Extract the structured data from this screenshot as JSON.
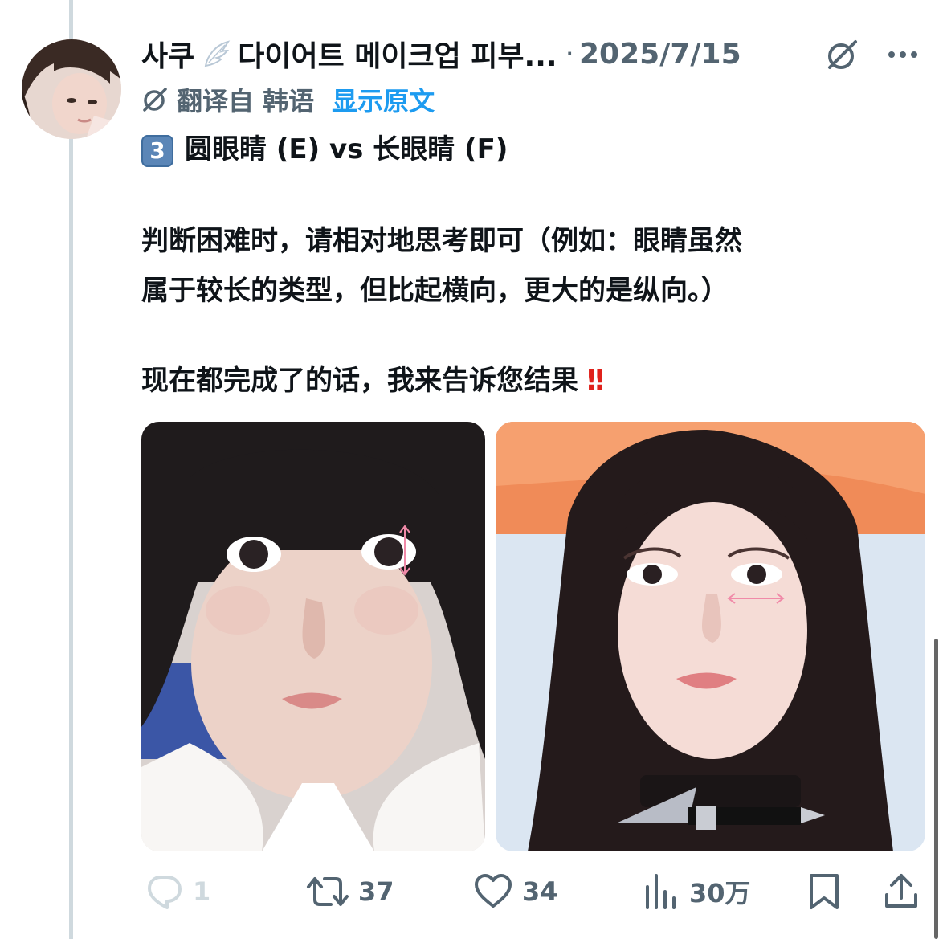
{
  "post": {
    "display_name": "사쿠",
    "name_rest": "다이어트 메이크업 피부...",
    "separator": "·",
    "date": "2025/7/15",
    "translated_from": "翻译自 韩语",
    "show_original": "显示原文",
    "keycap": "3",
    "heading": "圆眼睛 (E) vs 长眼睛 (F)",
    "line1": "判断困难时，请相对地思考即可（例如：眼睛虽然",
    "line2": "属于较长的类型，但比起横向，更大的是纵向。）",
    "line3": "现在都完成了的话，我来告诉您结果",
    "emoji_end": "!!"
  },
  "actions": {
    "replies": "1",
    "reposts": "37",
    "likes": "34",
    "views": "30万"
  },
  "colors": {
    "primary_text": "#0f1419",
    "secondary_text": "#536471",
    "link": "#1d9bf0",
    "thread_line": "#cfd9de"
  }
}
